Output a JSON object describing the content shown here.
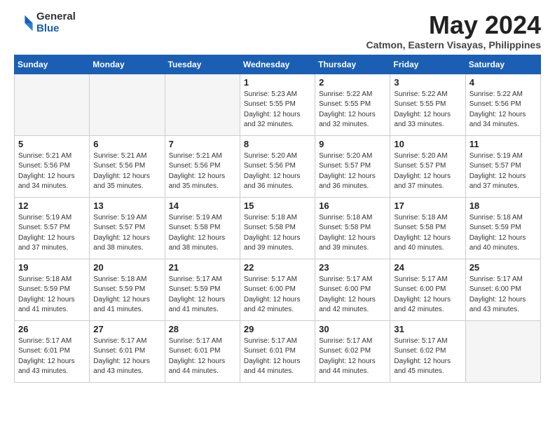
{
  "logo": {
    "general": "General",
    "blue": "Blue"
  },
  "title": {
    "month_year": "May 2024",
    "location": "Catmon, Eastern Visayas, Philippines"
  },
  "headers": [
    "Sunday",
    "Monday",
    "Tuesday",
    "Wednesday",
    "Thursday",
    "Friday",
    "Saturday"
  ],
  "weeks": [
    [
      {
        "day": "",
        "info": ""
      },
      {
        "day": "",
        "info": ""
      },
      {
        "day": "",
        "info": ""
      },
      {
        "day": "1",
        "info": "Sunrise: 5:23 AM\nSunset: 5:55 PM\nDaylight: 12 hours and 32 minutes."
      },
      {
        "day": "2",
        "info": "Sunrise: 5:22 AM\nSunset: 5:55 PM\nDaylight: 12 hours and 32 minutes."
      },
      {
        "day": "3",
        "info": "Sunrise: 5:22 AM\nSunset: 5:55 PM\nDaylight: 12 hours and 33 minutes."
      },
      {
        "day": "4",
        "info": "Sunrise: 5:22 AM\nSunset: 5:56 PM\nDaylight: 12 hours and 34 minutes."
      }
    ],
    [
      {
        "day": "5",
        "info": "Sunrise: 5:21 AM\nSunset: 5:56 PM\nDaylight: 12 hours and 34 minutes."
      },
      {
        "day": "6",
        "info": "Sunrise: 5:21 AM\nSunset: 5:56 PM\nDaylight: 12 hours and 35 minutes."
      },
      {
        "day": "7",
        "info": "Sunrise: 5:21 AM\nSunset: 5:56 PM\nDaylight: 12 hours and 35 minutes."
      },
      {
        "day": "8",
        "info": "Sunrise: 5:20 AM\nSunset: 5:56 PM\nDaylight: 12 hours and 36 minutes."
      },
      {
        "day": "9",
        "info": "Sunrise: 5:20 AM\nSunset: 5:57 PM\nDaylight: 12 hours and 36 minutes."
      },
      {
        "day": "10",
        "info": "Sunrise: 5:20 AM\nSunset: 5:57 PM\nDaylight: 12 hours and 37 minutes."
      },
      {
        "day": "11",
        "info": "Sunrise: 5:19 AM\nSunset: 5:57 PM\nDaylight: 12 hours and 37 minutes."
      }
    ],
    [
      {
        "day": "12",
        "info": "Sunrise: 5:19 AM\nSunset: 5:57 PM\nDaylight: 12 hours and 37 minutes."
      },
      {
        "day": "13",
        "info": "Sunrise: 5:19 AM\nSunset: 5:57 PM\nDaylight: 12 hours and 38 minutes."
      },
      {
        "day": "14",
        "info": "Sunrise: 5:19 AM\nSunset: 5:58 PM\nDaylight: 12 hours and 38 minutes."
      },
      {
        "day": "15",
        "info": "Sunrise: 5:18 AM\nSunset: 5:58 PM\nDaylight: 12 hours and 39 minutes."
      },
      {
        "day": "16",
        "info": "Sunrise: 5:18 AM\nSunset: 5:58 PM\nDaylight: 12 hours and 39 minutes."
      },
      {
        "day": "17",
        "info": "Sunrise: 5:18 AM\nSunset: 5:58 PM\nDaylight: 12 hours and 40 minutes."
      },
      {
        "day": "18",
        "info": "Sunrise: 5:18 AM\nSunset: 5:59 PM\nDaylight: 12 hours and 40 minutes."
      }
    ],
    [
      {
        "day": "19",
        "info": "Sunrise: 5:18 AM\nSunset: 5:59 PM\nDaylight: 12 hours and 41 minutes."
      },
      {
        "day": "20",
        "info": "Sunrise: 5:18 AM\nSunset: 5:59 PM\nDaylight: 12 hours and 41 minutes."
      },
      {
        "day": "21",
        "info": "Sunrise: 5:17 AM\nSunset: 5:59 PM\nDaylight: 12 hours and 41 minutes."
      },
      {
        "day": "22",
        "info": "Sunrise: 5:17 AM\nSunset: 6:00 PM\nDaylight: 12 hours and 42 minutes."
      },
      {
        "day": "23",
        "info": "Sunrise: 5:17 AM\nSunset: 6:00 PM\nDaylight: 12 hours and 42 minutes."
      },
      {
        "day": "24",
        "info": "Sunrise: 5:17 AM\nSunset: 6:00 PM\nDaylight: 12 hours and 42 minutes."
      },
      {
        "day": "25",
        "info": "Sunrise: 5:17 AM\nSunset: 6:00 PM\nDaylight: 12 hours and 43 minutes."
      }
    ],
    [
      {
        "day": "26",
        "info": "Sunrise: 5:17 AM\nSunset: 6:01 PM\nDaylight: 12 hours and 43 minutes."
      },
      {
        "day": "27",
        "info": "Sunrise: 5:17 AM\nSunset: 6:01 PM\nDaylight: 12 hours and 43 minutes."
      },
      {
        "day": "28",
        "info": "Sunrise: 5:17 AM\nSunset: 6:01 PM\nDaylight: 12 hours and 44 minutes."
      },
      {
        "day": "29",
        "info": "Sunrise: 5:17 AM\nSunset: 6:01 PM\nDaylight: 12 hours and 44 minutes."
      },
      {
        "day": "30",
        "info": "Sunrise: 5:17 AM\nSunset: 6:02 PM\nDaylight: 12 hours and 44 minutes."
      },
      {
        "day": "31",
        "info": "Sunrise: 5:17 AM\nSunset: 6:02 PM\nDaylight: 12 hours and 45 minutes."
      },
      {
        "day": "",
        "info": ""
      }
    ]
  ]
}
